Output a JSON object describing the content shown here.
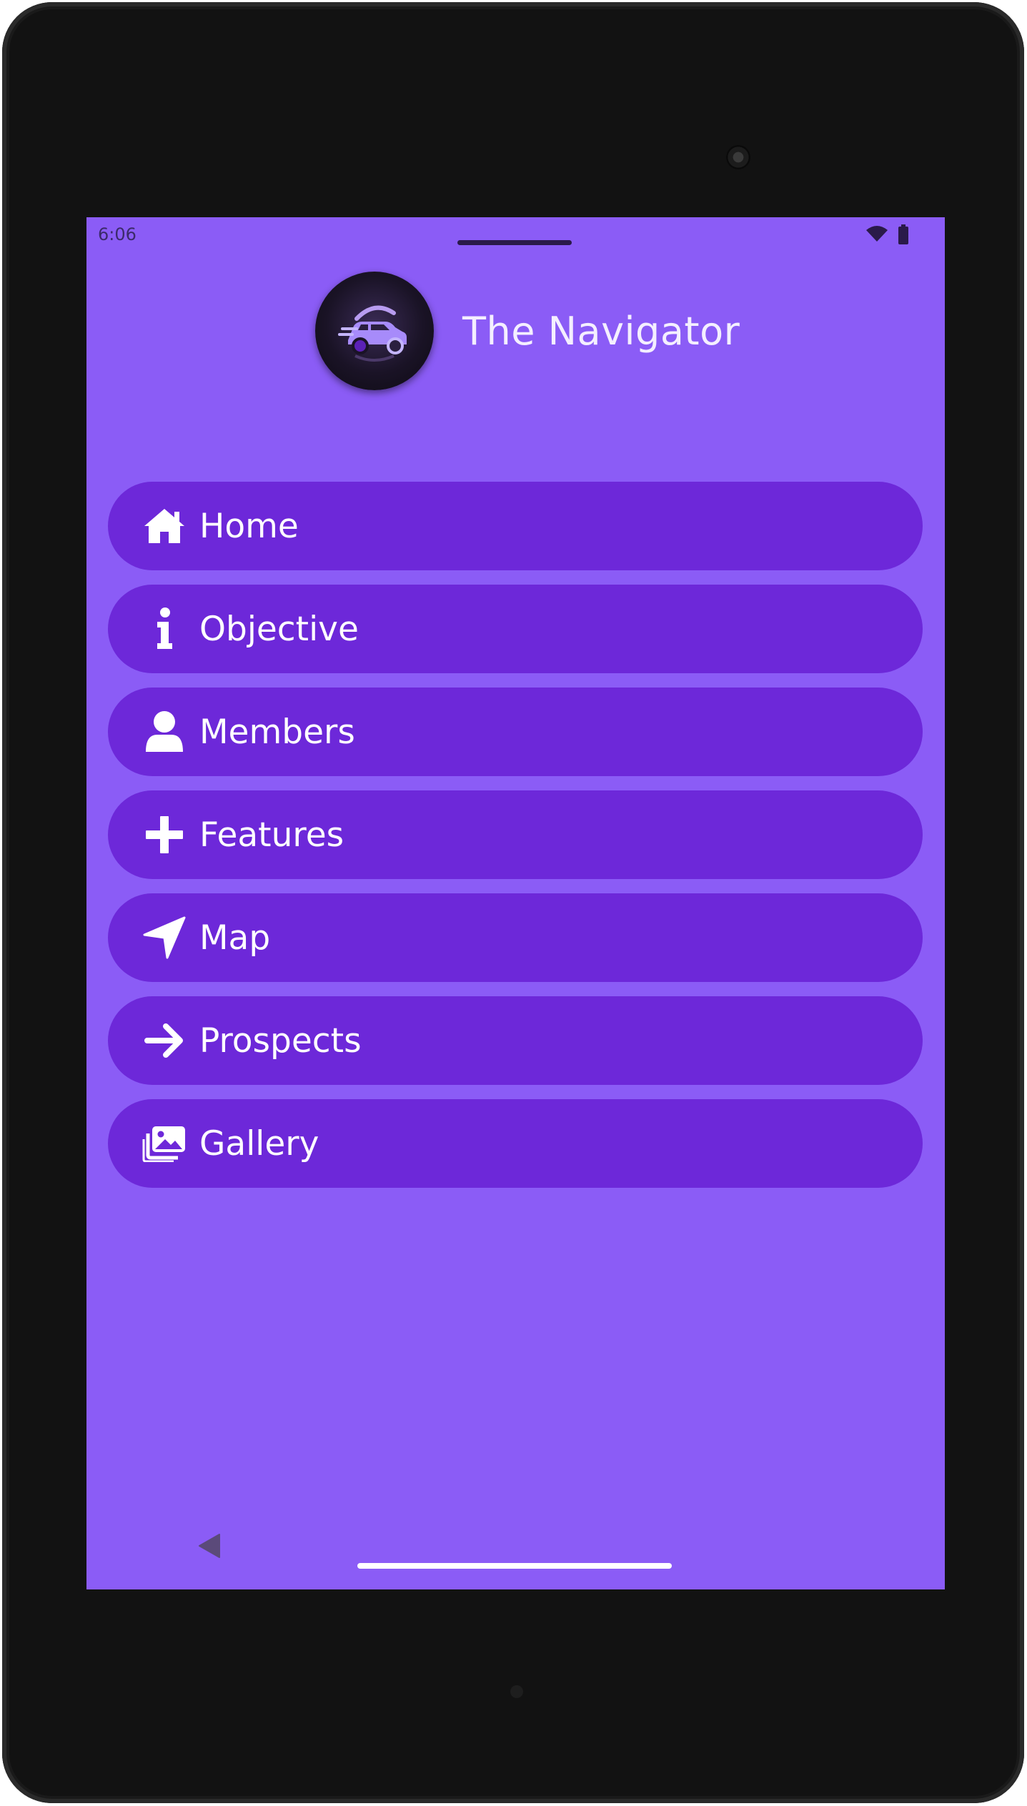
{
  "status_bar": {
    "time": "6:06",
    "icons": [
      "wifi-icon",
      "battery-icon"
    ]
  },
  "header": {
    "title": "The Navigator",
    "logo_icon": "car-logo-icon"
  },
  "menu": {
    "items": [
      {
        "label": "Home",
        "icon": "home-icon"
      },
      {
        "label": "Objective",
        "icon": "info-icon"
      },
      {
        "label": "Members",
        "icon": "user-icon"
      },
      {
        "label": "Features",
        "icon": "plus-icon"
      },
      {
        "label": "Map",
        "icon": "location-arrow-icon"
      },
      {
        "label": "Prospects",
        "icon": "arrow-right-icon"
      },
      {
        "label": "Gallery",
        "icon": "images-icon"
      }
    ]
  },
  "nav_bar": {
    "icons": [
      "back-icon",
      "home-gesture-bar"
    ]
  },
  "colors": {
    "background": "#8b5cf6",
    "button": "#6d28d9",
    "text": "#ffffff",
    "device_frame": "#121212"
  }
}
